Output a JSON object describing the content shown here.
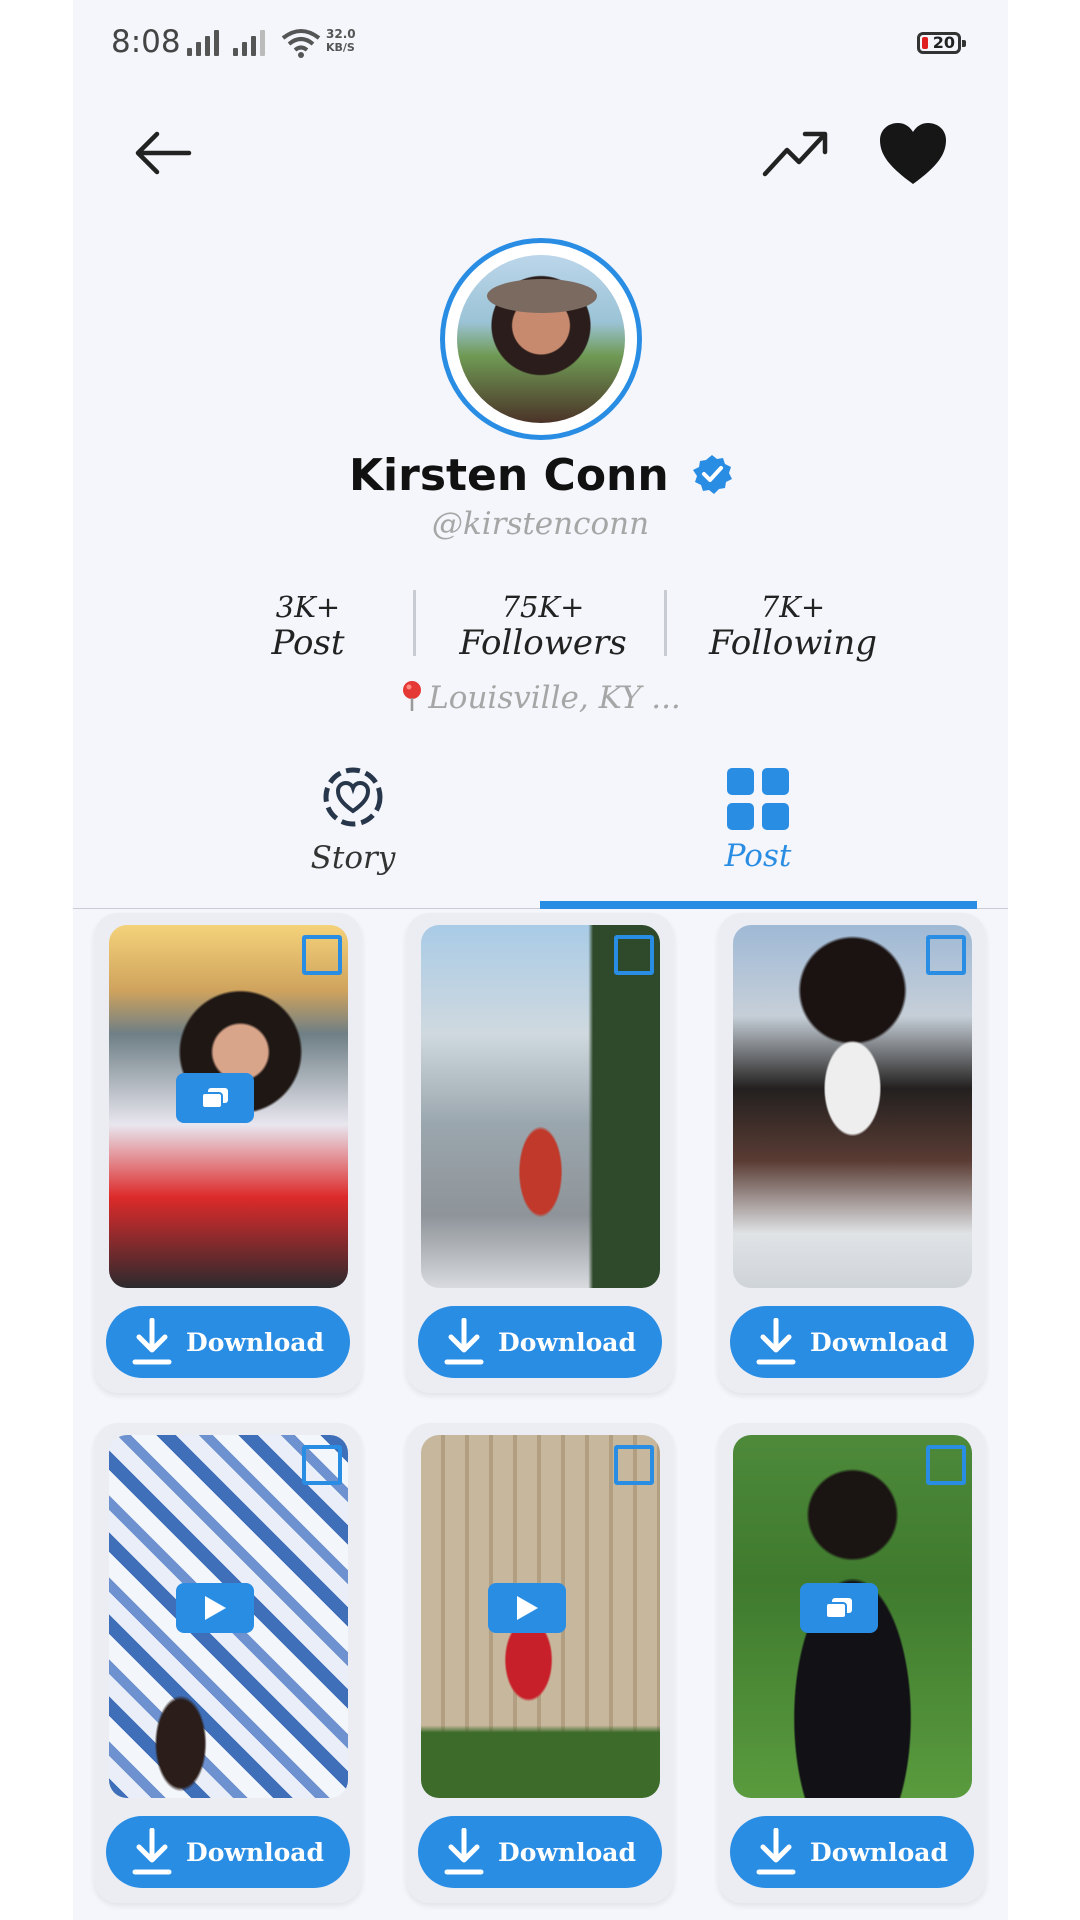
{
  "status_bar": {
    "time": "8:08",
    "speed_value": "32.0",
    "speed_unit": "KB/S",
    "battery": "20"
  },
  "header": {
    "back_icon": "arrow-left-icon",
    "trend_icon": "trending-up-icon",
    "favorite_icon": "heart-icon"
  },
  "profile": {
    "name": "Kirsten Conn",
    "handle": "@kirstenconn",
    "verified": true,
    "location": "Louisville, KY ...",
    "location_icon": "map-pin-icon"
  },
  "stats": [
    {
      "value": "3K+",
      "label": "Post"
    },
    {
      "value": "75K+",
      "label": "Followers"
    },
    {
      "value": "7K+",
      "label": "Following"
    }
  ],
  "tabs": [
    {
      "label": "Story",
      "icon": "story-heart-icon",
      "active": false
    },
    {
      "label": "Post",
      "icon": "grid-icon",
      "active": true
    }
  ],
  "posts": [
    {
      "media_type": "carousel",
      "download_label": "Download"
    },
    {
      "media_type": "image",
      "download_label": "Download"
    },
    {
      "media_type": "image",
      "download_label": "Download"
    },
    {
      "media_type": "video",
      "download_label": "Download"
    },
    {
      "media_type": "video",
      "download_label": "Download"
    },
    {
      "media_type": "carousel",
      "download_label": "Download"
    }
  ],
  "colors": {
    "accent": "#2a8de4",
    "background": "#f4f6fb",
    "card": "#ebedf3"
  }
}
